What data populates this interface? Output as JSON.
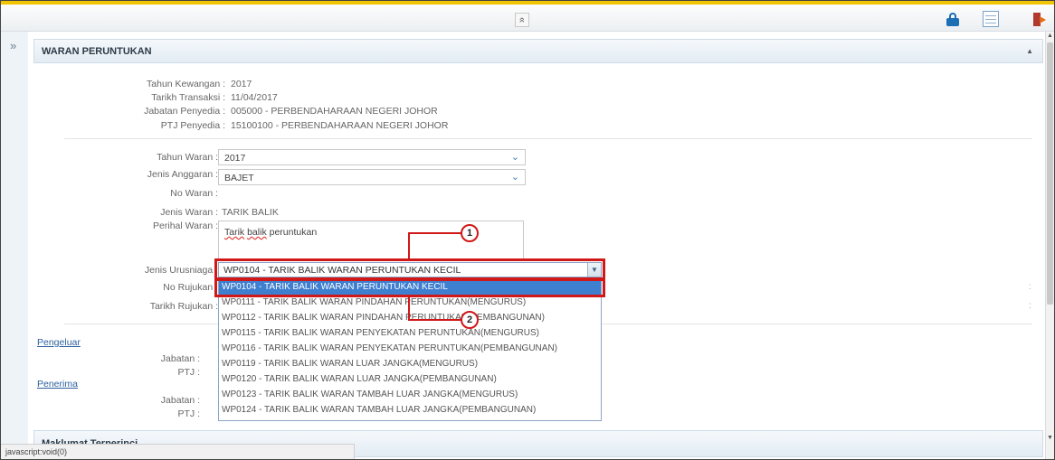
{
  "toolbar": {
    "collapse_glyph": "»",
    "icons": [
      "lock-icon",
      "table-icon",
      "exit-icon"
    ]
  },
  "sidebar": {
    "expand_glyph": "»"
  },
  "panel": {
    "title": "WARAN PERUNTUKAN"
  },
  "info": {
    "tahun_kewangan_label": "Tahun Kewangan :",
    "tahun_kewangan_value": "2017",
    "tarikh_transaksi_label": "Tarikh Transaksi :",
    "tarikh_transaksi_value": "11/04/2017",
    "jabatan_penyedia_label": "Jabatan Penyedia :",
    "jabatan_penyedia_value": "005000 - PERBENDAHARAAN NEGERI JOHOR",
    "ptj_penyedia_label": "PTJ Penyedia :",
    "ptj_penyedia_value": "15100100 - PERBENDAHARAAN NEGERI JOHOR"
  },
  "form": {
    "tahun_waran_label": "Tahun Waran :",
    "tahun_waran_value": "2017",
    "jenis_anggaran_label": "Jenis Anggaran :",
    "jenis_anggaran_value": "BAJET",
    "no_waran_label": "No Waran :",
    "jenis_waran_label": "Jenis Waran :",
    "jenis_waran_value": "TARIK BALIK",
    "perihal_waran_label": "Perihal Waran :",
    "perihal_waran_value_a": "Tarik",
    "perihal_waran_value_b": "balik",
    "perihal_waran_value_c": "peruntukan",
    "jenis_urusniaga_label": "Jenis Urusniaga :",
    "jenis_urusniaga_value": "WP0104 - TARIK BALIK WARAN PERUNTUKAN KECIL",
    "no_rujukan_label": "No Rujukan :",
    "tarikh_rujukan_label": "Tarikh Rujukan :"
  },
  "parties": {
    "pengeluar_label": "Pengeluar",
    "penerima_label": "Penerima",
    "jabatan_label": "Jabatan :",
    "ptj_label": "PTJ :"
  },
  "dropdown": {
    "options": [
      "WP0104 - TARIK BALIK WARAN PERUNTUKAN KECIL",
      "WP0111 - TARIK BALIK WARAN PINDAHAN PERUNTUKAN(MENGURUS)",
      "WP0112 - TARIK BALIK WARAN PINDAHAN PERUNTUKAN(PEMBANGUNAN)",
      "WP0115 - TARIK BALIK WARAN PENYEKATAN PERUNTUKAN(MENGURUS)",
      "WP0116 - TARIK BALIK WARAN PENYEKATAN PERUNTUKAN(PEMBANGUNAN)",
      "WP0119 - TARIK BALIK WARAN LUAR JANGKA(MENGURUS)",
      "WP0120 - TARIK BALIK WARAN LUAR JANGKA(PEMBANGUNAN)",
      "WP0123 - TARIK BALIK WARAN TAMBAH LUAR JANGKA(MENGURUS)",
      "WP0124 - TARIK BALIK WARAN TAMBAH LUAR JANGKA(PEMBANGUNAN)"
    ],
    "selected_index": 0
  },
  "callouts": {
    "one": "1",
    "two": "2"
  },
  "section2": {
    "title": "Maklumat Terperinci"
  },
  "status": {
    "text": "javascript:void(0)"
  },
  "colors": {
    "accent": "#3e7fd0",
    "highlight": "#d01818",
    "topline": "#f0c400"
  }
}
